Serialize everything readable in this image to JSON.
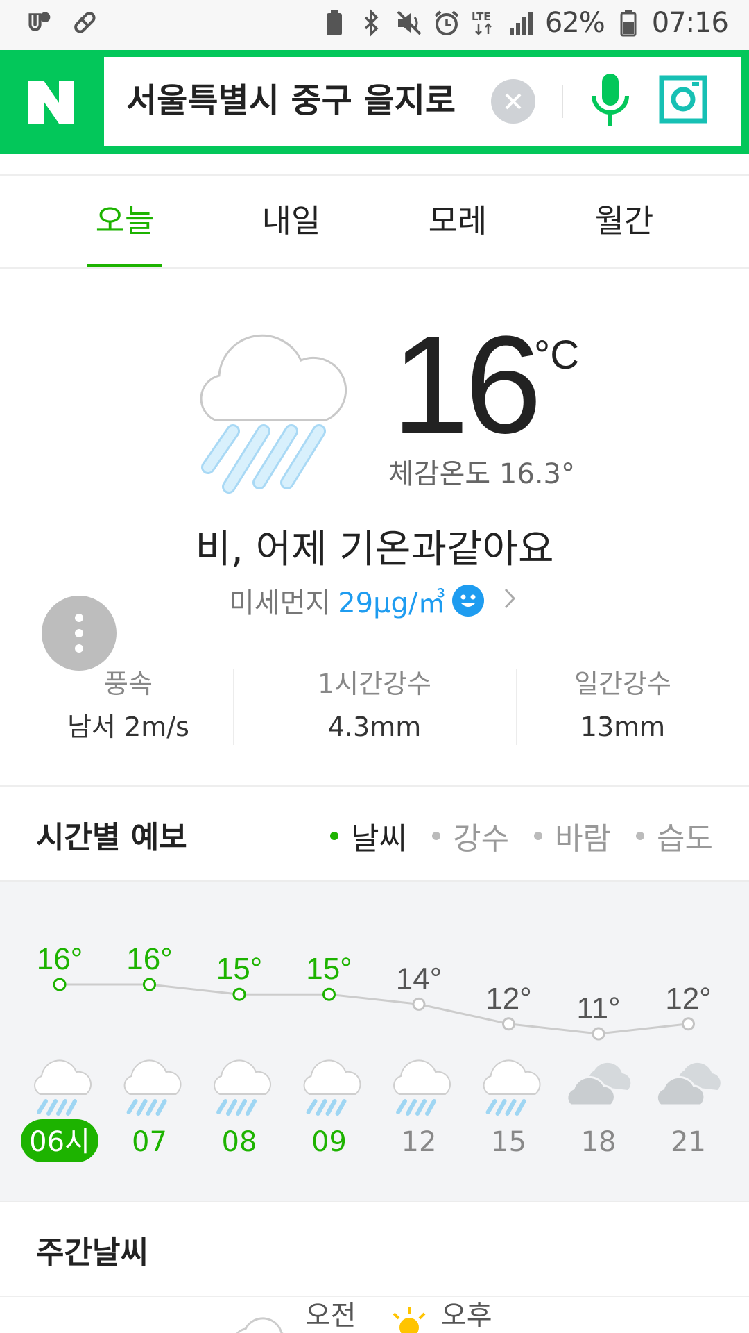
{
  "status_bar": {
    "battery": "62%",
    "time": "07:16",
    "network": "LTE"
  },
  "search": {
    "query": "서울특별시 중구 을지로",
    "logo": "N"
  },
  "tabs": [
    {
      "label": "오늘",
      "active": true
    },
    {
      "label": "내일",
      "active": false
    },
    {
      "label": "모레",
      "active": false
    },
    {
      "label": "월간",
      "active": false
    }
  ],
  "current": {
    "temperature": "16",
    "unit": "°C",
    "feels_like": "체감온도 16.3°",
    "summary": "비, 어제 기온과같아요",
    "dust_label": "미세먼지",
    "dust_value": "29μg/㎥",
    "condition_icon": "rain-cloud-icon"
  },
  "stats": [
    {
      "label": "풍속",
      "value": "남서 2m/s"
    },
    {
      "label": "1시간강수",
      "value": "4.3mm"
    },
    {
      "label": "일간강수",
      "value": "13mm"
    }
  ],
  "hourly": {
    "title": "시간별 예보",
    "modes": [
      {
        "label": "날씨",
        "active": true
      },
      {
        "label": "강수",
        "active": false
      },
      {
        "label": "바람",
        "active": false
      },
      {
        "label": "습도",
        "active": false
      }
    ],
    "colors": {
      "highlight": "#1db300",
      "normal": "#555555",
      "line": "#cccccc"
    }
  },
  "chart_data": {
    "type": "line",
    "x": [
      "06시",
      "07",
      "08",
      "09",
      "12",
      "15",
      "18",
      "21"
    ],
    "series": [
      {
        "values": [
          16,
          16,
          15,
          15,
          14,
          12,
          11,
          12
        ]
      }
    ],
    "point_labels": [
      "16°",
      "16°",
      "15°",
      "15°",
      "14°",
      "12°",
      "11°",
      "12°"
    ],
    "icons": [
      "rain-cloud-icon",
      "rain-cloud-icon",
      "rain-cloud-icon",
      "rain-cloud-icon",
      "rain-cloud-icon",
      "rain-cloud-icon",
      "cloudy-icon",
      "cloudy-icon"
    ],
    "highlighted_count": 4,
    "selected_index": 0
  },
  "weekly": {
    "title": "주간날씨",
    "am_label": "오전",
    "pm_label": "오후"
  }
}
